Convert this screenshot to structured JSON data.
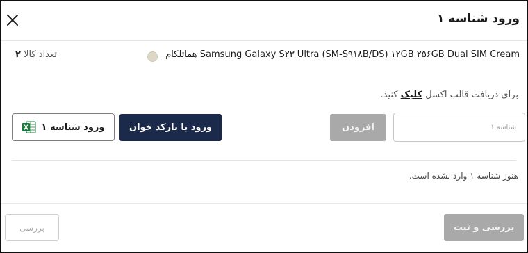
{
  "modal": {
    "title": "ورود شناسه ۱",
    "close_icon": "close-icon"
  },
  "product": {
    "name": "هماتلکام Samsung Galaxy S۲۳ Ultra (SM-S۹۱۸B/DS) ۱۲GB ۲۵۶GB Dual SIM Cream",
    "color_hex": "#ddd7c6",
    "qty_label": "تعداد کالا",
    "qty_value": "۲"
  },
  "hint": {
    "prefix": "برای دریافت قالب اکسل",
    "link": "کلیک",
    "suffix": "کنید."
  },
  "form": {
    "serial_placeholder": "شناسه ۱",
    "add_label": "افزودن",
    "barcode_label": "ورود با بارکد خوان",
    "excel_label": "ورود شناسه ۱",
    "excel_icon": "excel-icon"
  },
  "empty_message": "هنوز شناسه ۱ وارد نشده است.",
  "footer": {
    "review_label": "بررسی",
    "submit_label": "بررسی و ثبت"
  },
  "colors": {
    "primary": "#1b2a4a",
    "disabled": "#a9a9a9",
    "excel_green": "#1d7a3e"
  }
}
